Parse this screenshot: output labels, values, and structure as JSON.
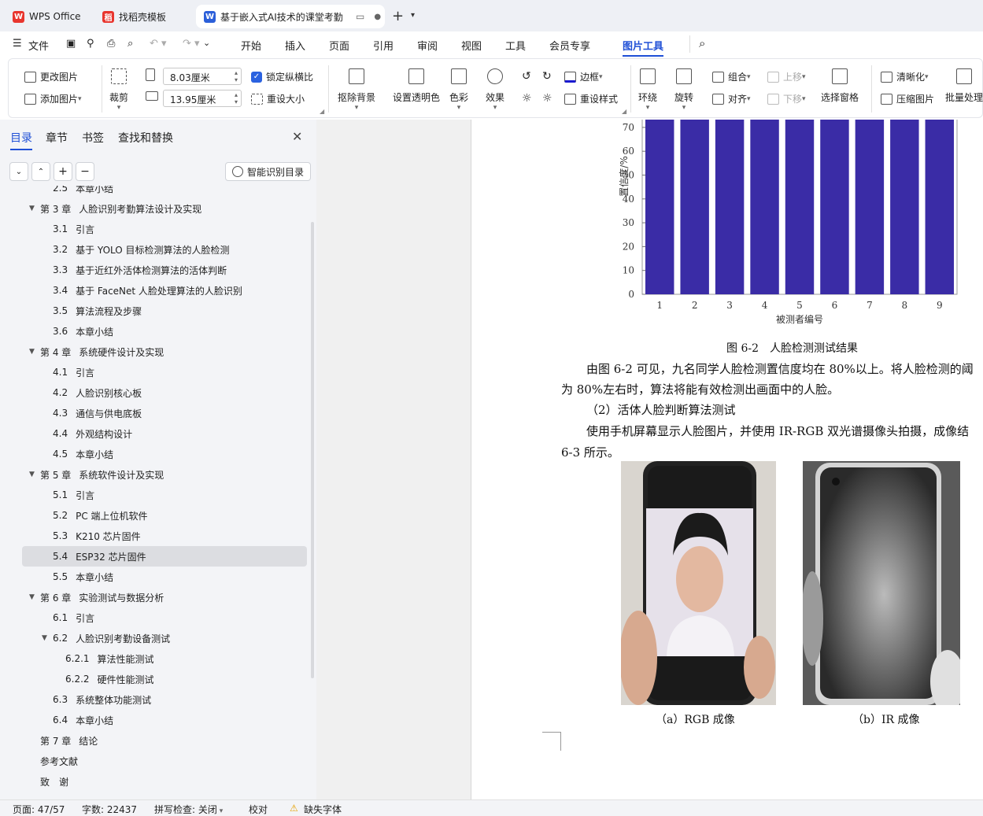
{
  "tabs": [
    {
      "label": "WPS Office",
      "logo": "W"
    },
    {
      "label": "找稻壳模板",
      "logo": "稻"
    },
    {
      "label": "基于嵌入式AI技术的课堂考勤",
      "logo": "W"
    }
  ],
  "menu": {
    "file": "文件",
    "items": [
      "开始",
      "插入",
      "页面",
      "引用",
      "审阅",
      "视图",
      "工具",
      "会员专享",
      "图片工具"
    ],
    "active": "图片工具"
  },
  "ribbon": {
    "change_image": "更改图片",
    "add_image": "添加图片",
    "crop": "裁剪",
    "width": "8.03厘米",
    "height": "13.95厘米",
    "lock_ratio": "锁定纵横比",
    "reset_size": "重设大小",
    "remove_bg": "抠除背景",
    "set_transparent": "设置透明色",
    "color": "色彩",
    "effect": "效果",
    "border": "边框",
    "reset_style": "重设样式",
    "wrap": "环绕",
    "rotate": "旋转",
    "group": "组合",
    "align": "对齐",
    "move_up": "上移",
    "move_down": "下移",
    "selection_pane": "选择窗格",
    "sharpen": "清晰化",
    "compress": "压缩图片",
    "batch": "批量处理"
  },
  "panel": {
    "tabs": [
      "目录",
      "章节",
      "书签",
      "查找和替换"
    ],
    "smart_toc": "智能识别目录",
    "toc": [
      {
        "num": "2.5",
        "title": "本章小结",
        "level": 2
      },
      {
        "num": "第 3 章",
        "title": "人脸识别考勤算法设计及实现",
        "level": 1,
        "arrow": true
      },
      {
        "num": "3.1",
        "title": "引言",
        "level": 2
      },
      {
        "num": "3.2",
        "title": "基于 YOLO 目标检测算法的人脸检测",
        "level": 2
      },
      {
        "num": "3.3",
        "title": "基于近红外活体检测算法的活体判断",
        "level": 2
      },
      {
        "num": "3.4",
        "title": "基于 FaceNet 人脸处理算法的人脸识别",
        "level": 2
      },
      {
        "num": "3.5",
        "title": "算法流程及步骤",
        "level": 2
      },
      {
        "num": "3.6",
        "title": "本章小结",
        "level": 2
      },
      {
        "num": "第 4 章",
        "title": "系统硬件设计及实现",
        "level": 1,
        "arrow": true
      },
      {
        "num": "4.1",
        "title": "引言",
        "level": 2
      },
      {
        "num": "4.2",
        "title": "人脸识别核心板",
        "level": 2
      },
      {
        "num": "4.3",
        "title": "通信与供电底板",
        "level": 2
      },
      {
        "num": "4.4",
        "title": "外观结构设计",
        "level": 2
      },
      {
        "num": "4.5",
        "title": "本章小结",
        "level": 2
      },
      {
        "num": "第 5 章",
        "title": "系统软件设计及实现",
        "level": 1,
        "arrow": true
      },
      {
        "num": "5.1",
        "title": "引言",
        "level": 2
      },
      {
        "num": "5.2",
        "title": "PC 端上位机软件",
        "level": 2
      },
      {
        "num": "5.3",
        "title": "K210 芯片固件",
        "level": 2
      },
      {
        "num": "5.4",
        "title": "ESP32 芯片固件",
        "level": 2,
        "selected": true
      },
      {
        "num": "5.5",
        "title": "本章小结",
        "level": 2
      },
      {
        "num": "第 6 章",
        "title": "实验测试与数据分析",
        "level": 1,
        "arrow": true
      },
      {
        "num": "6.1",
        "title": "引言",
        "level": 2
      },
      {
        "num": "6.2",
        "title": "人脸识别考勤设备测试",
        "level": 2,
        "arrow": true
      },
      {
        "num": "6.2.1",
        "title": "算法性能测试",
        "level": 3
      },
      {
        "num": "6.2.2",
        "title": "硬件性能测试",
        "level": 3
      },
      {
        "num": "6.3",
        "title": "系统整体功能测试",
        "level": 2
      },
      {
        "num": "6.4",
        "title": "本章小结",
        "level": 2
      },
      {
        "num": "第 7 章",
        "title": "结论",
        "level": 1
      },
      {
        "num": "参考文献",
        "title": "",
        "level": 1
      },
      {
        "num": "致　谢",
        "title": "",
        "level": 1
      }
    ]
  },
  "document": {
    "figure_caption": "图 6-2　人脸检测测试结果",
    "para1_line1": "由图 6-2 可见，九名同学人脸检测置信度均在 80%以上。将人脸检测的阈",
    "para1_line2": "为 80%左右时，算法将能有效检测出画面中的人脸。",
    "subheading": "（2）活体人脸判断算法测试",
    "para2_line1": "使用手机屏幕显示人脸图片，并使用 IR-RGB 双光谱摄像头拍摄，成像结",
    "para2_line2": "6-3 所示。",
    "caption_a": "（a）RGB 成像",
    "caption_b": "（b）IR 成像"
  },
  "chart_data": {
    "type": "bar",
    "categories": [
      "1",
      "2",
      "3",
      "4",
      "5",
      "6",
      "7",
      "8",
      "9"
    ],
    "values": [
      95,
      95,
      95,
      95,
      95,
      95,
      95,
      95,
      95
    ],
    "xlabel": "被测者编号",
    "ylabel": "置信度/%",
    "yticks": [
      0,
      10,
      20,
      30,
      40,
      50,
      60,
      70
    ],
    "ylim": [
      0,
      70
    ],
    "bar_color": "#3a2ca6"
  },
  "status": {
    "page": "页面: 47/57",
    "words": "字数: 22437",
    "spell": "拼写检查: 关闭",
    "proof": "校对",
    "missing_font": "缺失字体"
  }
}
